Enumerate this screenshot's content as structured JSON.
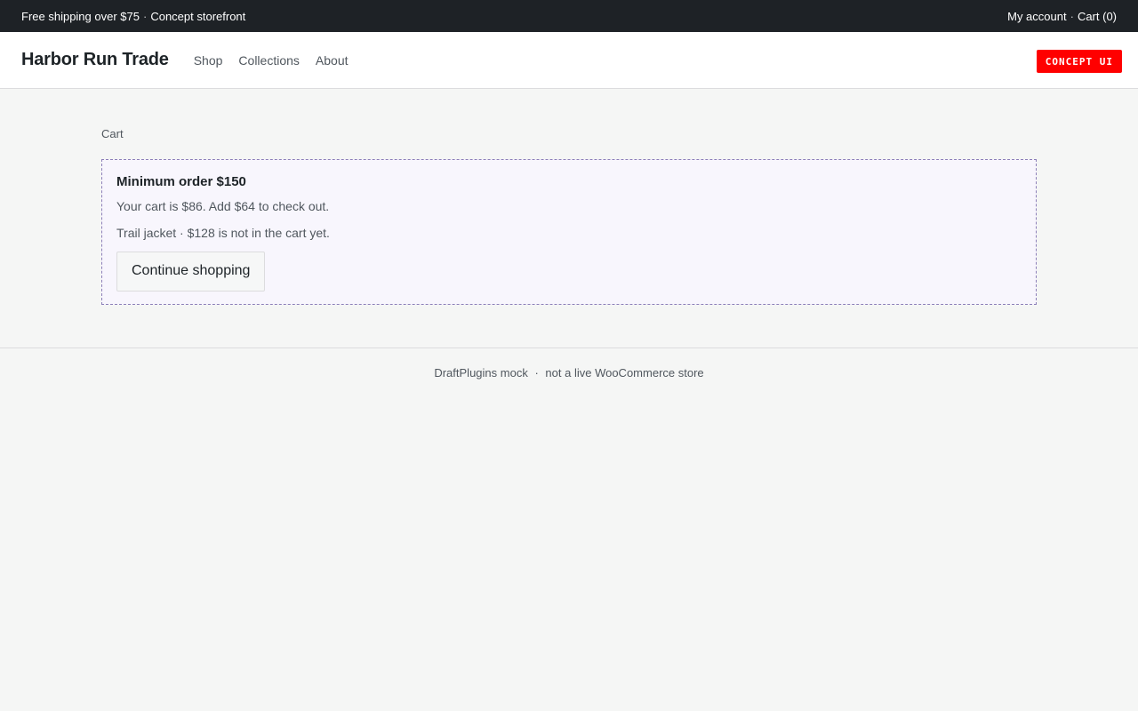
{
  "topbar": {
    "left_items": [
      "Free shipping over $75",
      "Concept storefront"
    ],
    "separator": "·",
    "account_link": "My account",
    "cart_link": "Cart (0)"
  },
  "header": {
    "brand": "Harbor Run Trade",
    "nav": [
      "Shop",
      "Collections",
      "About"
    ],
    "badge": "CONCEPT UI",
    "badge_color": "#ff0000"
  },
  "main": {
    "breadcrumb": "Cart",
    "notice": {
      "title": "Minimum order $150",
      "message": "Your cart is $86. Add $64 to check out.",
      "product_note": "Trail jacket · $128 is not in the cart yet.",
      "button_label": "Continue shopping"
    }
  },
  "footer": {
    "left": "DraftPlugins mock",
    "separator": "·",
    "right": "not a live WooCommerce store"
  }
}
